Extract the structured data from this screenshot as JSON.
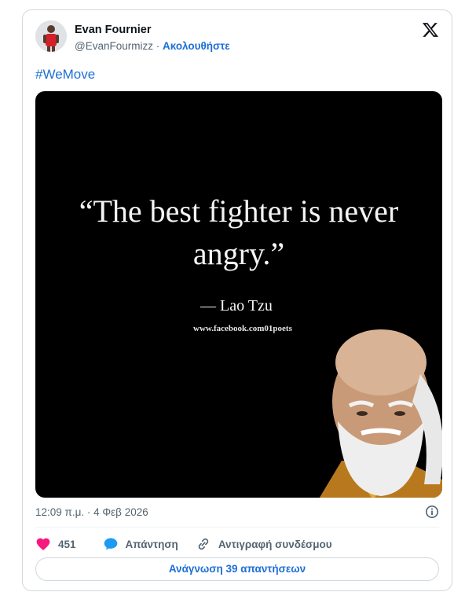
{
  "author": {
    "name": "Evan Fournier",
    "handle": "@EvanFourmizz",
    "separator": " · ",
    "follow_label": "Ακολουθήστε"
  },
  "post": {
    "hashtag": "#WeMove",
    "image": {
      "quote_line1": "“The best fighter is never",
      "quote_line2": "angry.”",
      "attribution": "— Lao Tzu",
      "source": "www.facebook.com01poets"
    },
    "timestamp": "12:09 π.μ. · 4 Φεβ 2026"
  },
  "actions": {
    "likes_count": "451",
    "reply_label": "Απάντηση",
    "copy_link_label": "Αντιγραφή συνδέσμου"
  },
  "read_replies_label": "Ανάγνωση 39 απαντήσεων",
  "colors": {
    "link": "#1d6fd6",
    "like": "#f91880",
    "reply": "#1d9bf0",
    "muted": "#536471"
  },
  "icons": [
    "x-logo-icon",
    "info-icon",
    "heart-icon",
    "speech-bubble-icon",
    "link-icon"
  ]
}
